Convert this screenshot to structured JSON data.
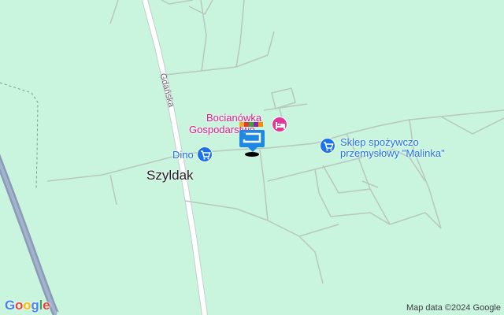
{
  "map": {
    "street_label": "Gdańska",
    "town_label": "Szyldak",
    "pois": {
      "dino": "Dino",
      "bocianowka_line1": "Bocianówka",
      "bocianowka_line2": "Gospodarstwo...",
      "sklep_line1": "Sklep spożywczo",
      "sklep_line2": "przemysłowy \"Malinka\""
    },
    "attribution": "Map data ©2024 Google",
    "logo_letters": [
      "G",
      "o",
      "o",
      "g",
      "l",
      "e"
    ],
    "colors": {
      "land": "#c9f4dd",
      "road_major": "#ffffff",
      "road_minor": "#b8c8c0",
      "highway": "#8a9bb8",
      "poi_blue": "#1a73e8",
      "poi_pink": "#e0389a"
    },
    "icons": {
      "dino": "shopping-cart-icon",
      "sklep": "shopping-cart-icon",
      "bocianowka": "bed-icon",
      "marker": "location-marker-icon"
    }
  }
}
